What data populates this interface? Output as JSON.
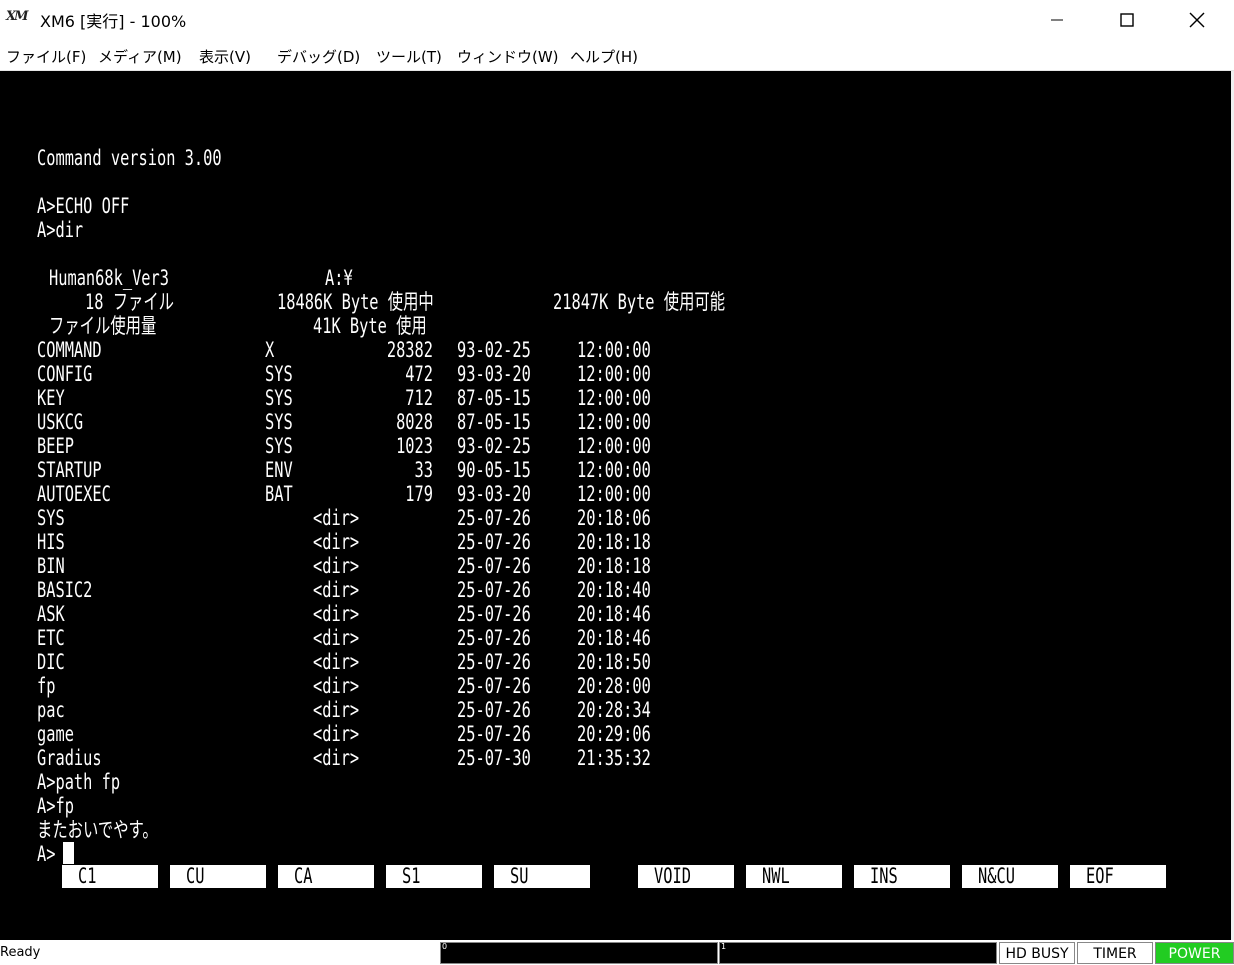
{
  "window": {
    "title": "XM6 [実行] - 100%",
    "icon": "xm6-logo-icon",
    "controls": [
      "minimize-icon",
      "maximize-icon",
      "close-icon"
    ]
  },
  "menu": [
    "ファイル(F)",
    "メディア(M)",
    "表示(V)",
    "デバッグ(D)",
    "ツール(T)",
    "ウィンドウ(W)",
    "ヘルプ(H)"
  ],
  "terminal": {
    "banner": "Command version 3.00",
    "cmd_echo": "A>ECHO OFF",
    "cmd_dir": "A>dir",
    "volume_name": "Human68k_Ver3",
    "volume_path": "A:¥",
    "file_count": "18 ファイル",
    "used": "18486K Byte 使用中",
    "free": "21847K Byte 使用可能",
    "usage": "ファイル使用量",
    "usage_value": "41K Byte 使用",
    "entries": [
      {
        "name": "COMMAND",
        "ext": "X",
        "size": "28382",
        "date": "93-02-25",
        "time": "12:00:00"
      },
      {
        "name": "CONFIG",
        "ext": "SYS",
        "size": "472",
        "date": "93-03-20",
        "time": "12:00:00"
      },
      {
        "name": "KEY",
        "ext": "SYS",
        "size": "712",
        "date": "87-05-15",
        "time": "12:00:00"
      },
      {
        "name": "USKCG",
        "ext": "SYS",
        "size": "8028",
        "date": "87-05-15",
        "time": "12:00:00"
      },
      {
        "name": "BEEP",
        "ext": "SYS",
        "size": "1023",
        "date": "93-02-25",
        "time": "12:00:00"
      },
      {
        "name": "STARTUP",
        "ext": "ENV",
        "size": "33",
        "date": "90-05-15",
        "time": "12:00:00"
      },
      {
        "name": "AUTOEXEC",
        "ext": "BAT",
        "size": "179",
        "date": "93-03-20",
        "time": "12:00:00"
      },
      {
        "name": "SYS",
        "ext": "",
        "size": "<dir>",
        "date": "25-07-26",
        "time": "20:18:06"
      },
      {
        "name": "HIS",
        "ext": "",
        "size": "<dir>",
        "date": "25-07-26",
        "time": "20:18:18"
      },
      {
        "name": "BIN",
        "ext": "",
        "size": "<dir>",
        "date": "25-07-26",
        "time": "20:18:18"
      },
      {
        "name": "BASIC2",
        "ext": "",
        "size": "<dir>",
        "date": "25-07-26",
        "time": "20:18:40"
      },
      {
        "name": "ASK",
        "ext": "",
        "size": "<dir>",
        "date": "25-07-26",
        "time": "20:18:46"
      },
      {
        "name": "ETC",
        "ext": "",
        "size": "<dir>",
        "date": "25-07-26",
        "time": "20:18:46"
      },
      {
        "name": "DIC",
        "ext": "",
        "size": "<dir>",
        "date": "25-07-26",
        "time": "20:18:50"
      },
      {
        "name": "fp",
        "ext": "",
        "size": "<dir>",
        "date": "25-07-26",
        "time": "20:28:00"
      },
      {
        "name": "pac",
        "ext": "",
        "size": "<dir>",
        "date": "25-07-26",
        "time": "20:28:34"
      },
      {
        "name": "game",
        "ext": "",
        "size": "<dir>",
        "date": "25-07-26",
        "time": "20:29:06"
      },
      {
        "name": "Gradius",
        "ext": "",
        "size": "<dir>",
        "date": "25-07-30",
        "time": "21:35:32"
      }
    ],
    "cmd_path": "A>path fp",
    "cmd_fp": "A>fp",
    "message": "またおいでやす。",
    "prompt": "A>"
  },
  "function_keys": [
    "C1",
    "CU",
    "CA",
    "S1",
    "SU",
    "VOID",
    "NWL",
    "INS",
    "N&CU",
    "EOF"
  ],
  "status": {
    "ready": "Ready",
    "drive0_label": "0",
    "drive1_label": "1",
    "hd_busy": "HD BUSY",
    "timer": "TIMER",
    "power": "POWER",
    "power_color": "#22cc22"
  }
}
